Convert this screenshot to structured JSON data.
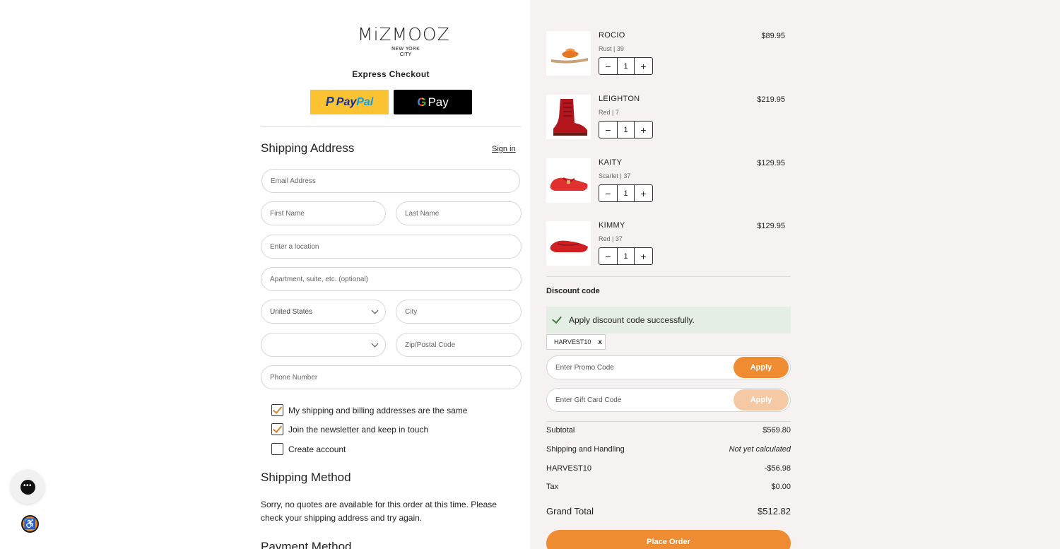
{
  "brand": {
    "logo_text": "MiZMOOZ",
    "logo_sub": "NEW YORK CITY"
  },
  "express": {
    "title": "Express Checkout",
    "paypal_pay": "Pay",
    "paypal_pal": "Pal",
    "gpay_g": "G",
    "gpay_text": "Pay"
  },
  "shipping": {
    "title": "Shipping Address",
    "sign_in": "Sign in",
    "fields": {
      "email": "Email Address",
      "first_name": "First Name",
      "last_name": "Last Name",
      "location": "Enter a location",
      "apartment": "Apartment, suite, etc. (optional)",
      "country": "United States",
      "city": "City",
      "state": "",
      "zip": "Zip/Postal Code",
      "phone": "Phone Number"
    },
    "checkboxes": [
      {
        "label": "My shipping and billing addresses are the same",
        "checked": true
      },
      {
        "label": "Join the newsletter and keep in touch",
        "checked": true
      },
      {
        "label": "Create account",
        "checked": false
      }
    ]
  },
  "shipping_method": {
    "title": "Shipping Method",
    "message": "Sorry, no quotes are available for this order at this time. Please check your shipping address and try again."
  },
  "payment_method": {
    "title": "Payment Method"
  },
  "cart": {
    "items": [
      {
        "name": "ROCIO",
        "variant": "Rust  |  39",
        "price": "$89.95",
        "qty": "1",
        "color": "#e8761f"
      },
      {
        "name": "LEIGHTON",
        "variant": "Red  |  7",
        "price": "$219.95",
        "qty": "1",
        "color": "#b3161c"
      },
      {
        "name": "KAITY",
        "variant": "Scarlet  |  37",
        "price": "$129.95",
        "qty": "1",
        "color": "#e0302f"
      },
      {
        "name": "KIMMY",
        "variant": "Red  |  37",
        "price": "$129.95",
        "qty": "1",
        "color": "#cf1f22"
      }
    ],
    "minus": "−",
    "plus": "+"
  },
  "discount": {
    "label": "Discount code",
    "success": "Apply discount code successfully.",
    "applied_code": "HARVEST10",
    "remove": "x",
    "promo_placeholder": "Enter Promo Code",
    "gift_placeholder": "Enter Gift Card Code",
    "apply": "Apply"
  },
  "summary": {
    "subtotal_label": "Subtotal",
    "subtotal": "$569.80",
    "shipping_label": "Shipping and Handling",
    "shipping": "Not yet calculated",
    "discount_label": "HARVEST10",
    "discount": "-$56.98",
    "tax_label": "Tax",
    "tax": "$0.00",
    "grand_label": "Grand Total",
    "grand": "$512.82"
  },
  "place_order": "Place Order",
  "widgets": {
    "chat": "•••",
    "accessibility": "♿"
  }
}
